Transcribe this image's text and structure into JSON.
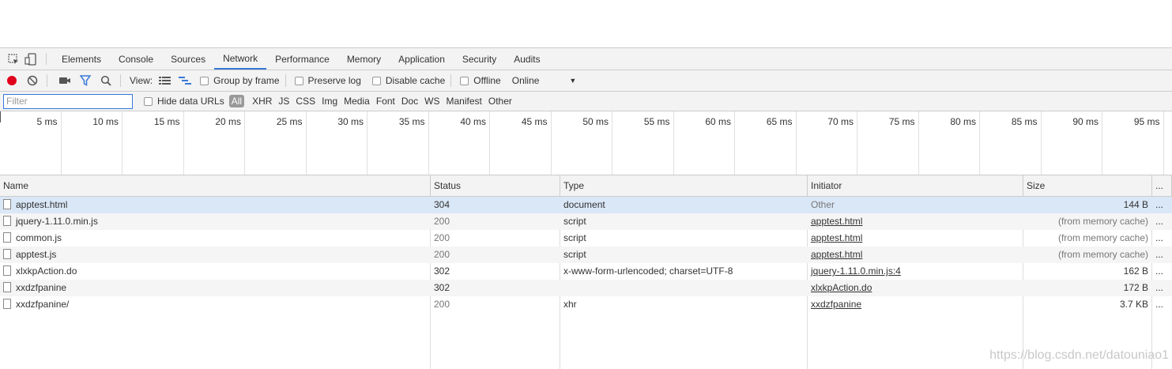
{
  "tabs": [
    "Elements",
    "Console",
    "Sources",
    "Network",
    "Performance",
    "Memory",
    "Application",
    "Security",
    "Audits"
  ],
  "active_tab": "Network",
  "toolbar": {
    "view_label": "View:",
    "group_by_frame": "Group by frame",
    "preserve_log": "Preserve log",
    "disable_cache": "Disable cache",
    "offline": "Offline",
    "throttle": "Online",
    "record_color": "#e0001b",
    "accent_color": "#3879d9"
  },
  "filter": {
    "placeholder": "Filter",
    "hide_data_urls": "Hide data URLs",
    "types": [
      "All",
      "XHR",
      "JS",
      "CSS",
      "Img",
      "Media",
      "Font",
      "Doc",
      "WS",
      "Manifest",
      "Other"
    ]
  },
  "timeline_ticks": [
    "5 ms",
    "10 ms",
    "15 ms",
    "20 ms",
    "25 ms",
    "30 ms",
    "35 ms",
    "40 ms",
    "45 ms",
    "50 ms",
    "55 ms",
    "60 ms",
    "65 ms",
    "70 ms",
    "75 ms",
    "80 ms",
    "85 ms",
    "90 ms",
    "95 ms"
  ],
  "table": {
    "headers": {
      "name": "Name",
      "status": "Status",
      "type": "Type",
      "initiator": "Initiator",
      "size": "Size",
      "more": "..."
    },
    "rows": [
      {
        "name": "apptest.html",
        "status": "304",
        "type": "document",
        "initiator": "Other",
        "size": "144 B"
      },
      {
        "name": "jquery-1.11.0.min.js",
        "status": "200",
        "type": "script",
        "initiator": "apptest.html",
        "size": "(from memory cache)"
      },
      {
        "name": "common.js",
        "status": "200",
        "type": "script",
        "initiator": "apptest.html",
        "size": "(from memory cache)"
      },
      {
        "name": "apptest.js",
        "status": "200",
        "type": "script",
        "initiator": "apptest.html",
        "size": "(from memory cache)"
      },
      {
        "name": "xlxkpAction.do",
        "status": "302",
        "type": "x-www-form-urlencoded; charset=UTF-8",
        "initiator": "jquery-1.11.0.min.js:4",
        "size": "162 B"
      },
      {
        "name": "xxdzfpanine",
        "status": "302",
        "type": "",
        "initiator": "xlxkpAction.do",
        "size": "172 B"
      },
      {
        "name": "xxdzfpanine/",
        "status": "200",
        "type": "xhr",
        "initiator": "xxdzfpanine",
        "size": "3.7 KB"
      }
    ],
    "row_more": "..."
  },
  "watermark": "https://blog.csdn.net/datouniao1"
}
